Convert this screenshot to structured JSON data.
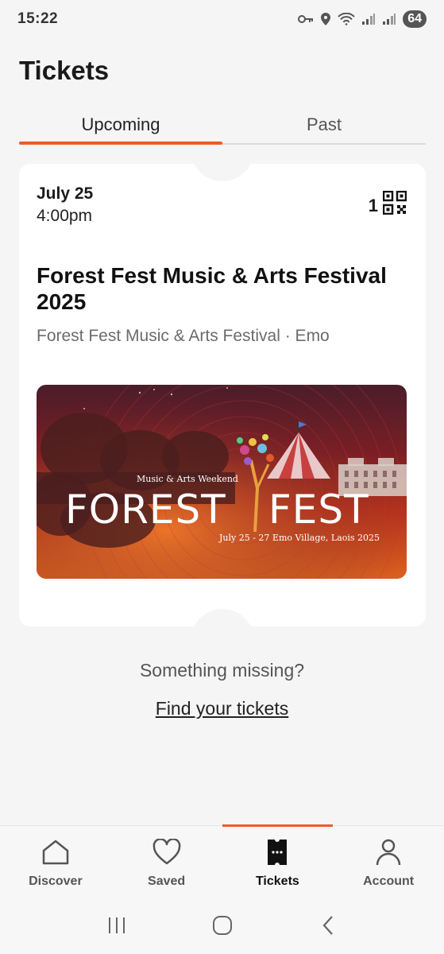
{
  "status_bar": {
    "time": "15:22",
    "battery": "64",
    "icons": [
      "key-icon",
      "location-icon",
      "wifi-icon",
      "signal-icon",
      "signal-icon"
    ]
  },
  "page": {
    "title": "Tickets"
  },
  "tabs": [
    {
      "label": "Upcoming",
      "active": true
    },
    {
      "label": "Past",
      "active": false
    }
  ],
  "ticket": {
    "date": "July 25",
    "time": "4:00pm",
    "count": "1",
    "title": "Forest Fest Music & Arts Festival 2025",
    "subtitle": "Forest Fest Music & Arts Festival · Emo",
    "banner": {
      "weekend": "Music & Arts Weekend",
      "word1": "FOREST",
      "word2": "FEST",
      "dates": "July 25 - 27 Emo Village, Laois 2025"
    }
  },
  "empty_hint": {
    "text": "Something missing?",
    "link": "Find your tickets"
  },
  "bottom_nav": [
    {
      "label": "Discover",
      "icon": "home-icon",
      "active": false
    },
    {
      "label": "Saved",
      "icon": "heart-icon",
      "active": false
    },
    {
      "label": "Tickets",
      "icon": "ticket-icon",
      "active": true
    },
    {
      "label": "Account",
      "icon": "person-icon",
      "active": false
    }
  ],
  "colors": {
    "accent": "#f05a28",
    "background": "#f5f5f5",
    "card": "#ffffff"
  }
}
